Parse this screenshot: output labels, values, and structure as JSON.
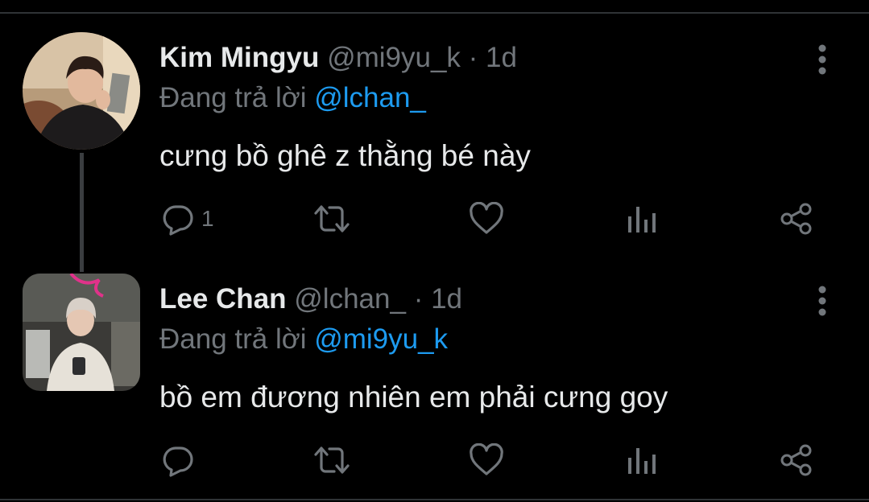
{
  "tweets": [
    {
      "name": "Kim Mingyu",
      "handle": "@mi9yu_k",
      "separator": "·",
      "time": "1d",
      "reply_prefix": "Đang trả lời",
      "reply_to": "@lchan_",
      "text": "cưng bồ ghê z thằng bé này",
      "reply_count": "1",
      "retweet_count": "",
      "like_count": ""
    },
    {
      "name": "Lee Chan",
      "handle": "@lchan_",
      "separator": "·",
      "time": "1d",
      "reply_prefix": "Đang trả lời",
      "reply_to": "@mi9yu_k",
      "text": "bồ em đương nhiên em phải cưng goy",
      "reply_count": "",
      "retweet_count": "",
      "like_count": ""
    }
  ],
  "colors": {
    "background": "#000000",
    "text": "#e7e9ea",
    "secondary": "#71767b",
    "mention": "#1d9bf0"
  },
  "icons": [
    "reply-icon",
    "retweet-icon",
    "like-icon",
    "views-icon",
    "share-icon",
    "more-options-icon"
  ]
}
